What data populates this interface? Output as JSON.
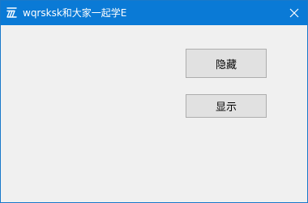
{
  "window": {
    "title": "wqrsksk和大家一起学E",
    "app_icon": "e-language-icon",
    "close_icon": "close-icon"
  },
  "buttons": {
    "hide_label": "隐藏",
    "show_label": "显示"
  },
  "colors": {
    "titlebar": "#0a7ad6",
    "window_bg": "#f0f0f0",
    "button_bg": "#e1e1e1",
    "button_border": "#adadad"
  }
}
